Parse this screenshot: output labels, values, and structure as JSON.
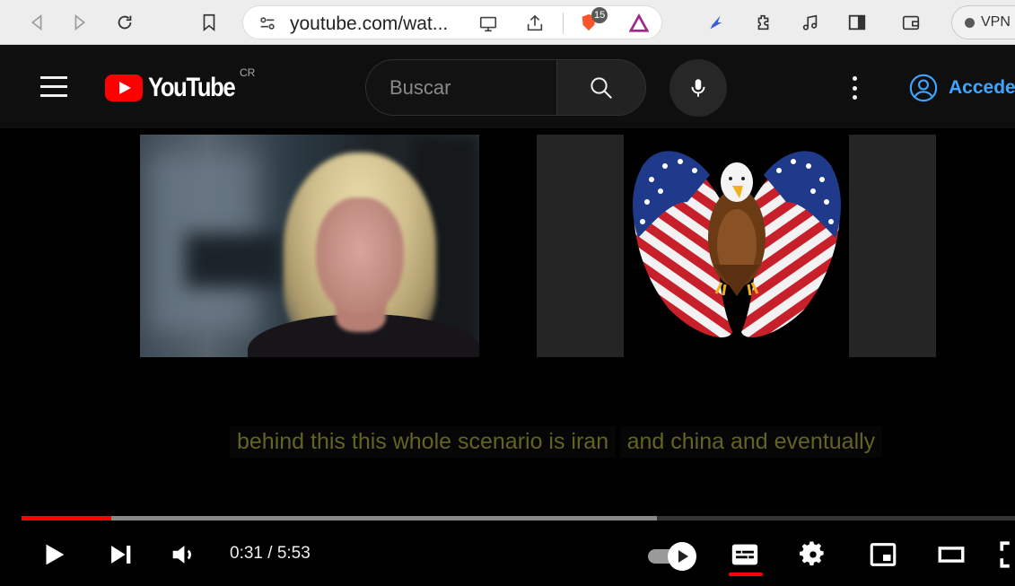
{
  "browser": {
    "url_text": "youtube.com/wat...",
    "shields_count": "15",
    "vpn_label": "VPN",
    "icons": [
      "back-icon",
      "forward-icon",
      "reload-icon",
      "bookmark-icon",
      "site-settings-icon",
      "cast-icon",
      "share-icon",
      "brave-shields-icon",
      "brave-rewards-icon",
      "leo-icon",
      "extensions-icon",
      "music-icon",
      "sidebar-icon",
      "wallet-icon",
      "vpn-icon"
    ]
  },
  "youtube": {
    "logo_text": "YouTube",
    "country_code": "CR",
    "search_placeholder": "Buscar",
    "signin_label": "Acceder",
    "accent_color": "#ff0000",
    "link_color": "#3ea6ff"
  },
  "video": {
    "caption_line1": "behind this this whole scenario is iran",
    "caption_line2": "and china and eventually",
    "time_display": "0:31 / 5:53",
    "played_fraction": 0.09,
    "buffered_fraction": 0.64,
    "captions_on": true,
    "autoplay_on": true
  }
}
